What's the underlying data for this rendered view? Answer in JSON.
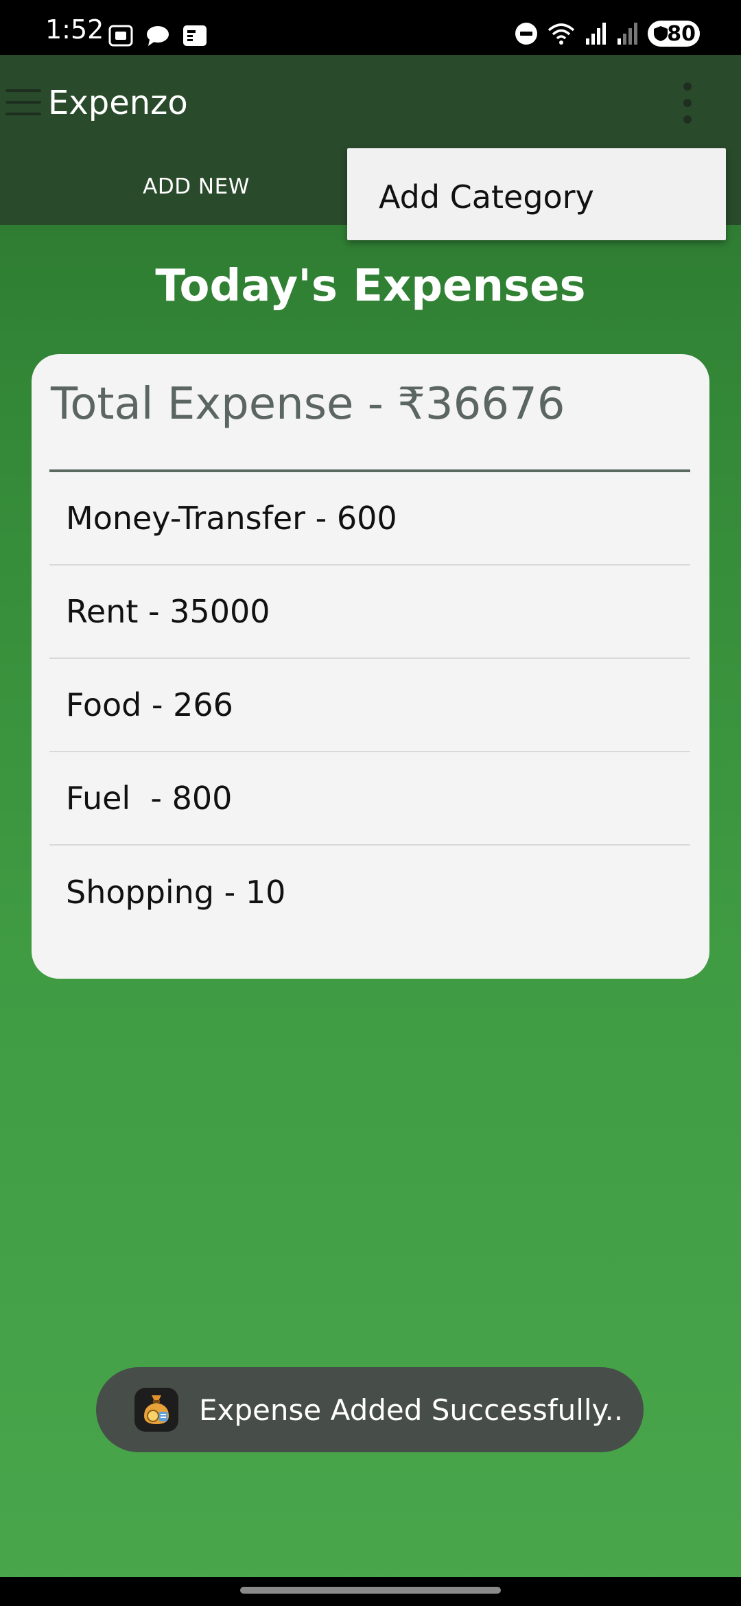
{
  "status_bar": {
    "time": "1:52",
    "battery": "80"
  },
  "app_bar": {
    "title": "Expenzo"
  },
  "tabs": {
    "add_new_label": "ADD NEW"
  },
  "dropdown": {
    "items": [
      {
        "label": "Add Category"
      }
    ]
  },
  "main": {
    "heading": "Today's Expenses",
    "total_expense": "Total Expense - ₹36676",
    "expenses": [
      {
        "label": "Money-Transfer - 600"
      },
      {
        "label": "Rent - 35000"
      },
      {
        "label": "Food - 266"
      },
      {
        "label": "Fuel  - 800"
      },
      {
        "label": "Shopping - 10"
      }
    ]
  },
  "toast": {
    "message": "Expense Added Successfully.."
  },
  "colors": {
    "app_bar": "#2a4a2c",
    "background_top": "#2a6e2e",
    "background_bottom": "#4aa64b",
    "card": "#f4f4f4",
    "toast": "#474e4a"
  },
  "icons": {
    "status_left": [
      "screenshot-icon",
      "chat-bubble-icon",
      "news-icon"
    ],
    "status_right": [
      "do-not-disturb-icon",
      "wifi-icon",
      "signal-icon",
      "signal-weak-icon",
      "shield-icon"
    ],
    "app_bar": [
      "hamburger-menu-icon",
      "overflow-menu-icon"
    ],
    "toast": "money-bag-icon"
  }
}
